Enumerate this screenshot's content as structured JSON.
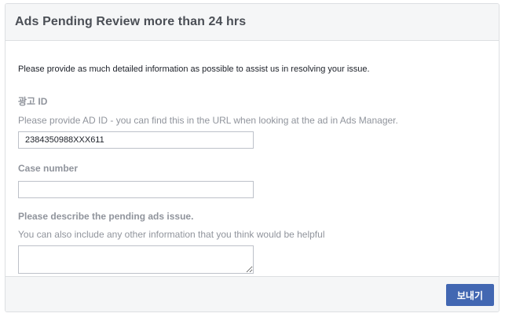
{
  "header": {
    "title": "Ads Pending Review more than 24 hrs"
  },
  "form": {
    "intro": "Please provide as much detailed information as possible to assist us in resolving your issue.",
    "ad_id": {
      "label": "광고 ID",
      "help": "Please provide AD ID - you can find this in the URL when looking at the ad in Ads Manager.",
      "value": "2384350988XXX611"
    },
    "case_number": {
      "label": "Case number",
      "value": ""
    },
    "issue_description": {
      "label": "Please describe the pending ads issue.",
      "help": "You can also include any other information that you think would be helpful",
      "value": ""
    }
  },
  "footer": {
    "submit_label": "보내기"
  },
  "colors": {
    "accent": "#4267b2",
    "header_bg": "#f5f6f7",
    "muted_text": "#90949c",
    "title_text": "#4b4f56"
  }
}
